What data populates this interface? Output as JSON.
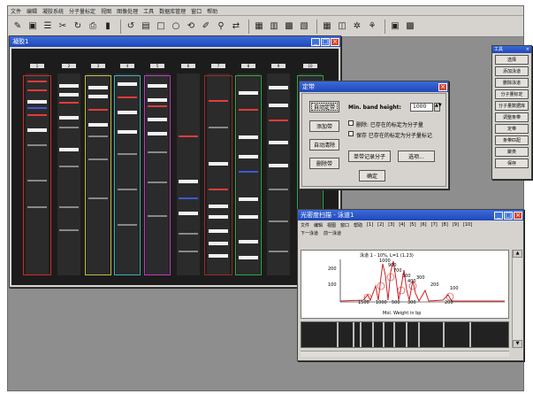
{
  "menu": [
    "文件",
    "编辑",
    "凝胶系统",
    "分子量标定",
    "视图",
    "图像处理",
    "工具",
    "数据库管理",
    "窗口",
    "帮助"
  ],
  "toolbar_icons": [
    "new-icon",
    "save-icon",
    "grid-icon",
    "link-icon",
    "refresh-icon",
    "print-icon",
    "book-icon",
    "undo-icon",
    "lane-icon",
    "rect-icon",
    "circle-icon",
    "rotate-icon",
    "draw-icon",
    "zoom-icon",
    "flip-icon",
    "grid2-icon",
    "chart-icon",
    "table-icon",
    "bands-icon",
    "matrix-icon",
    "fit-icon",
    "network-icon",
    "gel-icon",
    "mask-icon",
    "book2-icon"
  ],
  "gel_window": {
    "title": "凝胶1",
    "lanes": [
      "1",
      "2",
      "3",
      "4",
      "5",
      "6",
      "7",
      "8",
      "9",
      "10"
    ]
  },
  "dialog": {
    "title": "定带",
    "buttons": [
      "自动定带",
      "添加带",
      "自动清除",
      "删除带",
      "单带记录分子",
      "选项..."
    ],
    "ok": "确定",
    "min_band_label": "Min. band height:",
    "min_band_value": "1000",
    "check1": "删除: 已存在的标定为分子量",
    "check2": "保存 已存在的标定为分子量标记"
  },
  "palette": {
    "title": "工具",
    "buttons": [
      "选择",
      "添加泳道",
      "删除泳道",
      "分子量标定",
      "分子量数据库",
      "调整条带",
      "定带",
      "条带匹配",
      "聚类",
      "保存"
    ]
  },
  "densitometry": {
    "title": "光密度扫描 - 泳道1",
    "menu": [
      "文件",
      "编辑",
      "视图",
      "窗口",
      "帮助",
      "[1]",
      "[2]",
      "[3]",
      "[4]",
      "[5]",
      "[6]",
      "[7]",
      "[8]",
      "[9]",
      "[10]"
    ],
    "sub": [
      "下一泳道",
      "前一泳道"
    ],
    "plot_title": "泳道 1 - 10%, L=1 (1.23)",
    "x_label": "Mol. Weight in bp",
    "y_ticks": [
      "200",
      "100"
    ],
    "x_ticks": [
      "1500",
      "1000",
      "500",
      "300",
      "200"
    ],
    "peak_labels": [
      "1000",
      "900",
      "700",
      "500",
      "400",
      "300",
      "200",
      "100"
    ]
  },
  "colors": {
    "titlebar": "#2654c4",
    "gel_bg": "#1c1c1c",
    "lane_box": "#d42a2a",
    "trace": "#cc2222"
  }
}
